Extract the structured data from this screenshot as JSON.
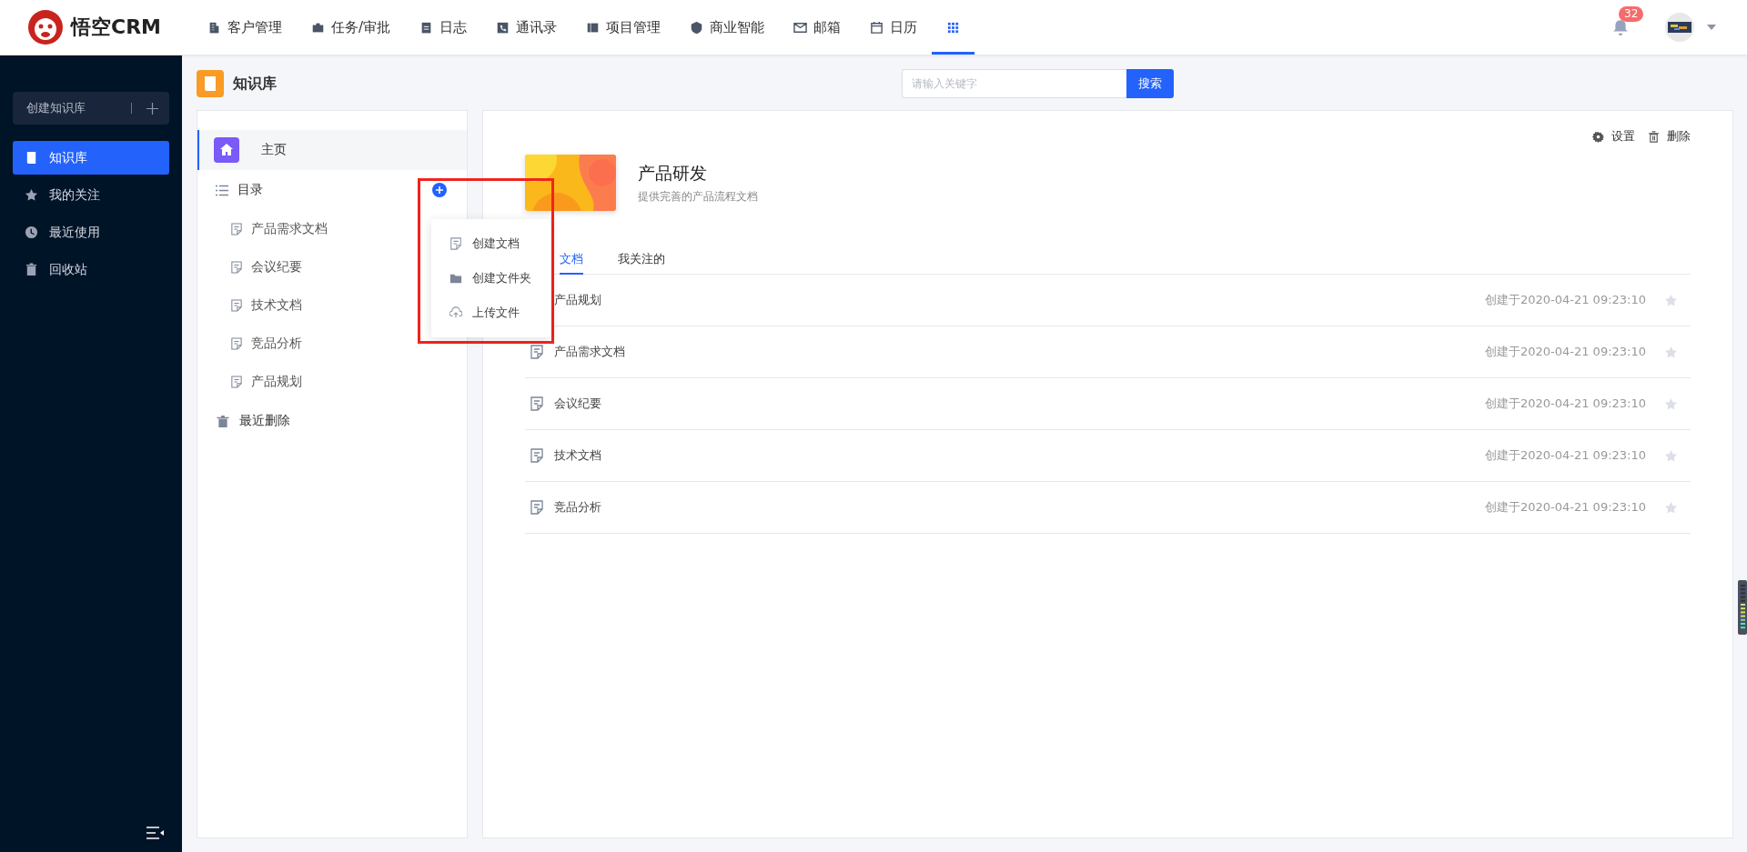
{
  "brand": {
    "name": "悟空CRM"
  },
  "nav": [
    {
      "label": "客户管理",
      "selected": false
    },
    {
      "label": "任务/审批",
      "selected": false
    },
    {
      "label": "日志",
      "selected": false
    },
    {
      "label": "通讯录",
      "selected": false
    },
    {
      "label": "项目管理",
      "selected": false
    },
    {
      "label": "商业智能",
      "selected": false
    },
    {
      "label": "邮箱",
      "selected": false
    },
    {
      "label": "日历",
      "selected": false
    }
  ],
  "apps_button": {
    "selected": true
  },
  "notifications": {
    "count": "32"
  },
  "sidebar": {
    "create_button": "创建知识库",
    "items": [
      {
        "label": "知识库",
        "selected": true
      },
      {
        "label": "我的关注",
        "selected": false
      },
      {
        "label": "最近使用",
        "selected": false
      },
      {
        "label": "回收站",
        "selected": false
      }
    ]
  },
  "page": {
    "title": "知识库",
    "search": {
      "placeholder": "请输入关键字",
      "button": "搜索"
    }
  },
  "tree": {
    "home": {
      "label": "主页",
      "selected": true
    },
    "catalog": {
      "label": "目录",
      "children": [
        {
          "label": "产品需求文档"
        },
        {
          "label": "会议纪要"
        },
        {
          "label": "技术文档"
        },
        {
          "label": "竞品分析"
        },
        {
          "label": "产品规划"
        }
      ]
    },
    "deleted": {
      "label": "最近删除"
    }
  },
  "add_menu": {
    "items": [
      {
        "label": "创建文档"
      },
      {
        "label": "创建文件夹"
      },
      {
        "label": "上传文件"
      }
    ]
  },
  "library": {
    "title": "产品研发",
    "description": "提供完善的产品流程文档",
    "actions": [
      {
        "label": "设置"
      },
      {
        "label": "删除"
      }
    ],
    "tabs": [
      {
        "label": "文档",
        "selected": true
      },
      {
        "label": "我关注的",
        "selected": false
      }
    ],
    "documents": [
      {
        "name": "产品规划",
        "created": "创建于2020-04-21 09:23:10",
        "starred": false
      },
      {
        "name": "产品需求文档",
        "created": "创建于2020-04-21 09:23:10",
        "starred": false
      },
      {
        "name": "会议纪要",
        "created": "创建于2020-04-21 09:23:10",
        "starred": false
      },
      {
        "name": "技术文档",
        "created": "创建于2020-04-21 09:23:10",
        "starred": false
      },
      {
        "name": "竞品分析",
        "created": "创建于2020-04-21 09:23:10",
        "starred": false
      }
    ]
  }
}
